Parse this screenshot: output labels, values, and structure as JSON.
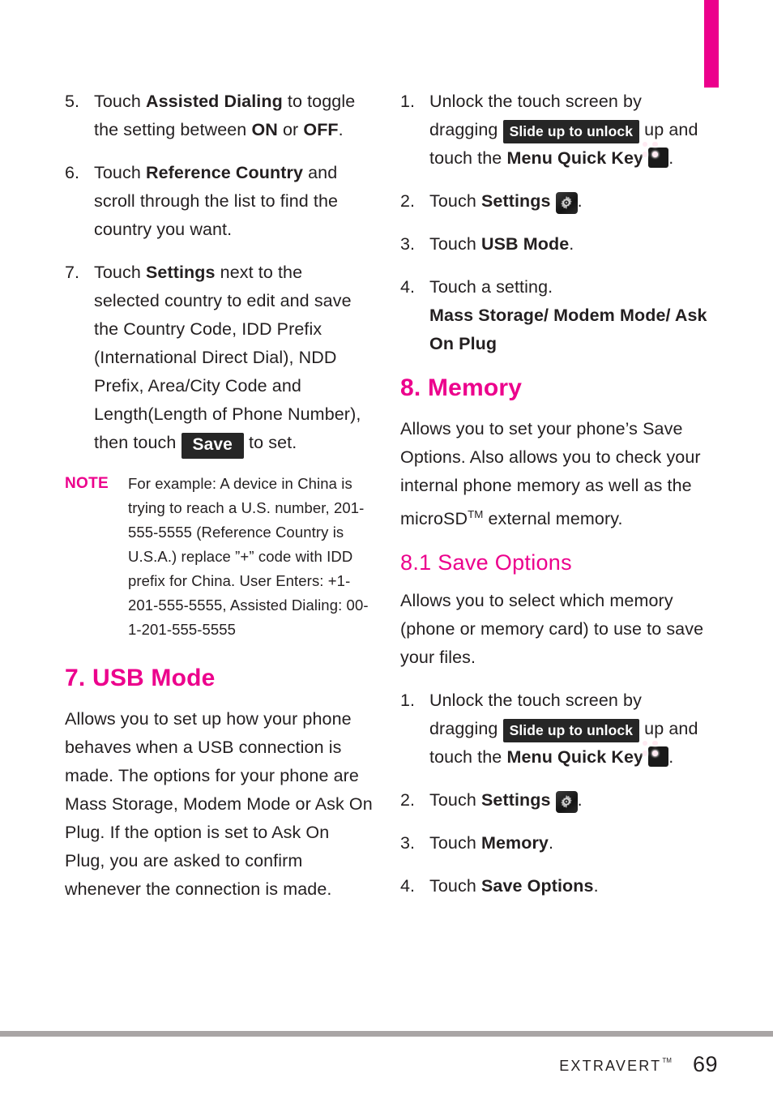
{
  "colors": {
    "accent_pink": "#EC008C",
    "text": "#231F20",
    "badge_bg": "#262626",
    "footer_rule": "#A9A5A5"
  },
  "tab_marker": {
    "name": "chapter-tab-marker",
    "color": "#EC008C"
  },
  "left_column": {
    "steps_continued": [
      {
        "num": "5.",
        "parts": [
          {
            "type": "text",
            "text": "Touch "
          },
          {
            "type": "bold",
            "text": "Assisted Dialing"
          },
          {
            "type": "text",
            "text": " to toggle the setting between "
          },
          {
            "type": "bold",
            "text": "ON"
          },
          {
            "type": "text",
            "text": " or "
          },
          {
            "type": "bold",
            "text": "OFF"
          },
          {
            "type": "text",
            "text": "."
          }
        ]
      },
      {
        "num": "6.",
        "parts": [
          {
            "type": "text",
            "text": "Touch "
          },
          {
            "type": "bold",
            "text": "Reference Country"
          },
          {
            "type": "text",
            "text": " and scroll through the list to find the country you want."
          }
        ]
      },
      {
        "num": "7.",
        "parts": [
          {
            "type": "text",
            "text": "Touch "
          },
          {
            "type": "bold",
            "text": "Settings"
          },
          {
            "type": "text",
            "text": " next to the selected country to edit and save the Country Code, IDD Prefix (International Direct Dial), NDD Prefix, Area/City Code and Length(Length of Phone Number), then touch "
          },
          {
            "type": "badge",
            "text": "Save"
          },
          {
            "type": "text",
            "text": " to set."
          }
        ]
      }
    ],
    "note": {
      "label": "NOTE",
      "body": "For example: A device in China is trying to reach a U.S. number, 201-555-5555 (Reference Country is U.S.A.) replace ”+” code with IDD prefix for China. User Enters: +1-201-555-5555, Assisted Dialing: 00-1-201-555-5555"
    },
    "section_heading": "7. USB Mode",
    "section_body": "Allows you to set up how your phone behaves when a USB connection is made. The options for your phone are Mass Storage, Modem Mode or Ask On Plug. If the option is set to Ask On Plug, you are asked to confirm whenever the connection is made."
  },
  "right_column": {
    "usb_steps": [
      {
        "num": "1.",
        "parts": [
          {
            "type": "text",
            "text": "Unlock the touch screen by dragging "
          },
          {
            "type": "badge-slide",
            "text": "Slide up to unlock"
          },
          {
            "type": "text",
            "text": " up and touch the "
          },
          {
            "type": "bold",
            "text": "Menu Quick Key"
          },
          {
            "type": "icon",
            "icon": "menu-quick-key-icon"
          },
          {
            "type": "text",
            "text": "."
          }
        ]
      },
      {
        "num": "2.",
        "parts": [
          {
            "type": "text",
            "text": "Touch "
          },
          {
            "type": "bold",
            "text": "Settings"
          },
          {
            "type": "icon",
            "icon": "settings-gear-icon"
          },
          {
            "type": "text",
            "text": "."
          }
        ]
      },
      {
        "num": "3.",
        "parts": [
          {
            "type": "text",
            "text": "Touch "
          },
          {
            "type": "bold",
            "text": "USB Mode"
          },
          {
            "type": "text",
            "text": "."
          }
        ]
      },
      {
        "num": "4.",
        "parts": [
          {
            "type": "text",
            "text": "Touch a setting."
          },
          {
            "type": "break"
          },
          {
            "type": "bold",
            "text": "Mass Storage/ Modem Mode/ Ask On Plug"
          }
        ]
      }
    ],
    "memory_heading": "8. Memory",
    "memory_body_1": "Allows you to set your phone’s Save Options. Also allows you to check your internal phone memory as well as the microSD",
    "memory_body_tm": "TM",
    "memory_body_2": " external memory.",
    "save_options_heading": "8.1 Save Options",
    "save_options_body": "Allows you to select which memory (phone or memory card) to use to save your files.",
    "save_options_steps": [
      {
        "num": "1.",
        "parts": [
          {
            "type": "text",
            "text": "Unlock the touch screen by dragging "
          },
          {
            "type": "badge-slide",
            "text": "Slide up to unlock"
          },
          {
            "type": "text",
            "text": " up and touch the "
          },
          {
            "type": "bold",
            "text": "Menu Quick Key"
          },
          {
            "type": "icon",
            "icon": "menu-quick-key-icon"
          },
          {
            "type": "text",
            "text": "."
          }
        ]
      },
      {
        "num": "2.",
        "parts": [
          {
            "type": "text",
            "text": "Touch "
          },
          {
            "type": "bold",
            "text": "Settings"
          },
          {
            "type": "icon",
            "icon": "settings-gear-icon"
          },
          {
            "type": "text",
            "text": "."
          }
        ]
      },
      {
        "num": "3.",
        "parts": [
          {
            "type": "text",
            "text": "Touch "
          },
          {
            "type": "bold",
            "text": "Memory"
          },
          {
            "type": "text",
            "text": "."
          }
        ]
      },
      {
        "num": "4.",
        "parts": [
          {
            "type": "text",
            "text": "Touch "
          },
          {
            "type": "bold",
            "text": "Save Options"
          },
          {
            "type": "text",
            "text": "."
          }
        ]
      }
    ]
  },
  "footer": {
    "brand": "Extravert",
    "trademark": "TM",
    "page_number": "69"
  }
}
